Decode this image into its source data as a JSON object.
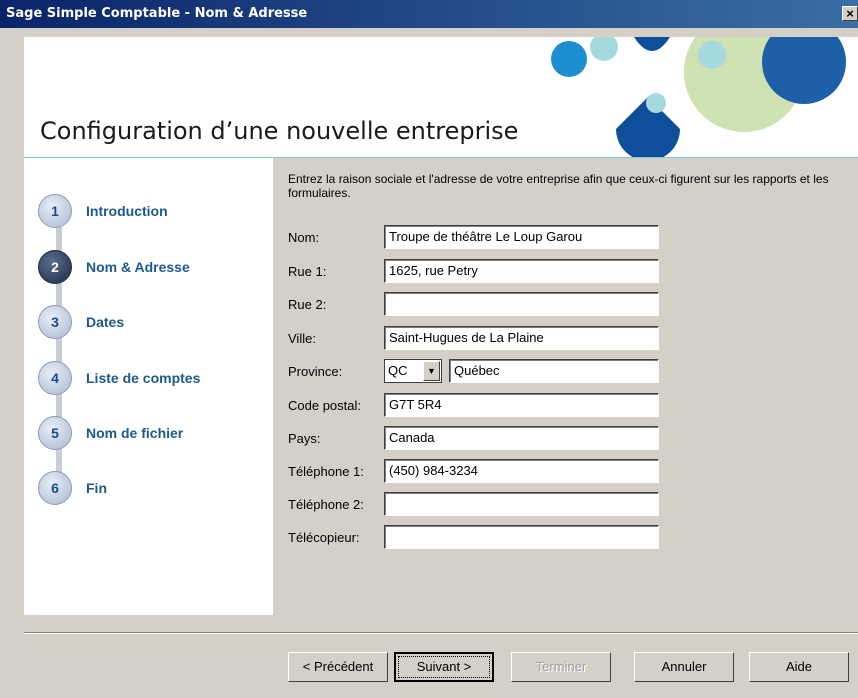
{
  "window": {
    "title": "Sage Simple Comptable - Nom & Adresse",
    "close_label": "×"
  },
  "header": {
    "title": "Configuration d’une nouvelle entreprise"
  },
  "steps": [
    {
      "num": "1",
      "label": "Introduction"
    },
    {
      "num": "2",
      "label": "Nom & Adresse"
    },
    {
      "num": "3",
      "label": "Dates"
    },
    {
      "num": "4",
      "label": "Liste de comptes"
    },
    {
      "num": "5",
      "label": "Nom de fichier"
    },
    {
      "num": "6",
      "label": "Fin"
    }
  ],
  "form": {
    "intro": "Entrez la raison sociale et l'adresse de votre entreprise afin que ceux-ci figurent sur les rapports et les formulaires.",
    "nom": {
      "label": "Nom:",
      "value": "Troupe de théâtre Le Loup Garou"
    },
    "rue1": {
      "label": "Rue 1:",
      "value": "1625, rue Petry"
    },
    "rue2": {
      "label": "Rue 2:",
      "value": ""
    },
    "ville": {
      "label": "Ville:",
      "value": "Saint-Hugues de La Plaine"
    },
    "province": {
      "label": "Province:",
      "code": "QC",
      "name": "Québec"
    },
    "code_postal": {
      "label": "Code postal:",
      "value": "G7T 5R4"
    },
    "pays": {
      "label": "Pays:",
      "value": "Canada"
    },
    "telephone1": {
      "label": "Téléphone 1:",
      "value": "(450) 984-3234"
    },
    "telephone2": {
      "label": "Téléphone 2:",
      "value": ""
    },
    "telecopieur": {
      "label": "Télécopieur:",
      "value": ""
    }
  },
  "buttons": {
    "precedent": "< Précédent",
    "suivant": "Suivant >",
    "terminer": "Terminer",
    "annuler": "Annuler",
    "aide": "Aide"
  }
}
